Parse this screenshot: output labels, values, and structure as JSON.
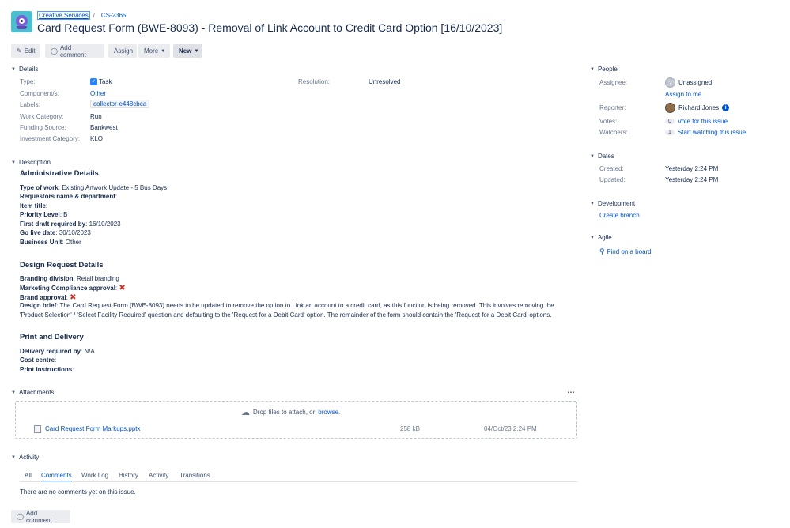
{
  "breadcrumb": {
    "project": "Creative Services",
    "separator": "/",
    "issue_key": "CS-2365"
  },
  "title": "Card Request Form (BWE-8093) - Removal of Link Account to Credit Card Option [16/10/2023]",
  "toolbar": {
    "edit": "Edit",
    "add_comment": "Add comment",
    "assign": "Assign",
    "more": "More",
    "new": "New"
  },
  "details": {
    "heading": "Details",
    "type_label": "Type:",
    "type_value": "Task",
    "components_label": "Component/s:",
    "components_value": "Other",
    "labels_label": "Labels:",
    "labels_value": "collector-e448cbca",
    "work_category_label": "Work Category:",
    "work_category_value": "Run",
    "funding_source_label": "Funding Source:",
    "funding_source_value": "Bankwest",
    "investment_category_label": "Investment Category:",
    "investment_category_value": "KLO",
    "resolution_label": "Resolution:",
    "resolution_value": "Unresolved"
  },
  "description": {
    "heading": "Description",
    "admin_heading": "Administrative Details",
    "type_of_work_label": "Type of work",
    "type_of_work_value": ": Existing Artwork Update - 5 Bus Days",
    "requestors_label": "Requestors name & department",
    "requestors_value": ":",
    "item_title_label": "Item title",
    "item_title_value": ":",
    "priority_label": "Priority Level",
    "priority_value": ": B",
    "first_draft_label": "First draft required by",
    "first_draft_value": ": 16/10/2023",
    "go_live_label": "Go live date",
    "go_live_value": ": 30/10/2023",
    "business_unit_label": "Business Unit",
    "business_unit_value": ": Other",
    "design_heading": "Design Request Details",
    "branding_label": "Branding division",
    "branding_value": ": Retail branding",
    "marketing_label": "Marketing Compliance approval",
    "marketing_value": ":",
    "brand_approval_label": "Brand approval",
    "brand_approval_value": ":",
    "design_brief_label": "Design brief",
    "design_brief_line1": ": The Card Request Form (BWE-8093) needs to be updated to remove the option to Link an account to a credit card, as this function is being removed. This involves removing the",
    "design_brief_line2": "'Product Selection' / 'Select Facility Required' question and defaulting to the 'Request for a Debit Card' option. The remainder of the form should contain the 'Request for a Debit Card' options.",
    "print_heading": "Print and Delivery",
    "delivery_label": "Delivery required by",
    "delivery_value": ": N/A",
    "cost_centre_label": "Cost centre",
    "cost_centre_value": ":",
    "print_instructions_label": "Print instructions",
    "print_instructions_value": ":"
  },
  "attachments": {
    "heading": "Attachments",
    "more": "…",
    "drop_text": "Drop files to attach, or",
    "browse": "browse.",
    "file_name": "Card Request Form Markups.pptx",
    "file_size": "258 kB",
    "file_date": "04/Oct/23 2:24 PM"
  },
  "activity": {
    "heading": "Activity",
    "tabs": [
      "All",
      "Comments",
      "Work Log",
      "History",
      "Activity",
      "Transitions"
    ],
    "empty": "There are no comments yet on this issue.",
    "add_comment": "Add comment"
  },
  "people": {
    "heading": "People",
    "assignee_label": "Assignee:",
    "assignee_value": "Unassigned",
    "assign_to_me": "Assign to me",
    "reporter_label": "Reporter:",
    "reporter_value": "Richard Jones",
    "votes_label": "Votes:",
    "votes_count": "0",
    "votes_link": "Vote for this issue",
    "watchers_label": "Watchers:",
    "watchers_count": "1",
    "watchers_link": "Start watching this issue"
  },
  "dates": {
    "heading": "Dates",
    "created_label": "Created:",
    "created_value": "Yesterday 2:24 PM",
    "updated_label": "Updated:",
    "updated_value": "Yesterday 2:24 PM"
  },
  "development": {
    "heading": "Development",
    "create_branch": "Create branch"
  },
  "agile": {
    "heading": "Agile",
    "find_on_board": "Find on a board"
  },
  "colors": {
    "link": "#0052cc",
    "text": "#172b4d",
    "muted": "#6b778c",
    "cross": "#c9372c"
  }
}
